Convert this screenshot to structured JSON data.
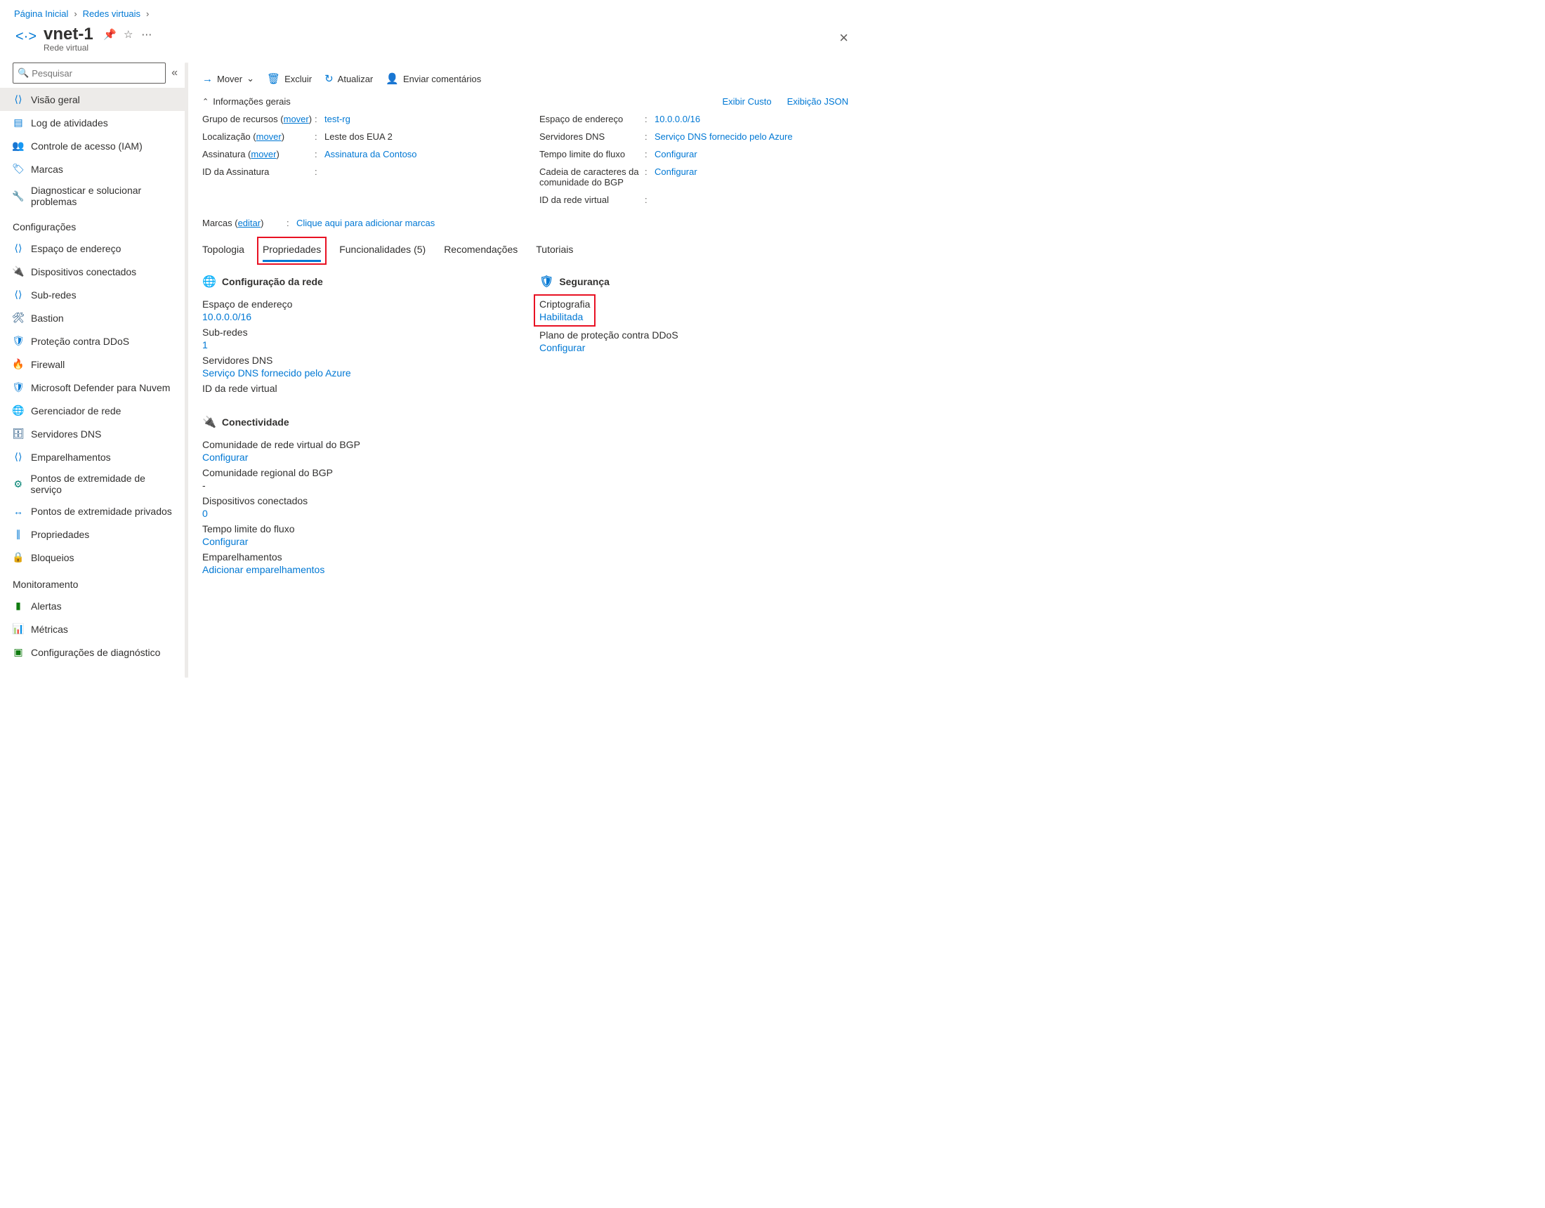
{
  "breadcrumb": {
    "home": "Página Inicial",
    "vnets": "Redes virtuais"
  },
  "header": {
    "title": "vnet-1",
    "subtitle": "Rede virtual"
  },
  "search_placeholder": "Pesquisar",
  "nav": {
    "overview": "Visão geral",
    "activity": "Log de atividades",
    "iam": "Controle de acesso (IAM)",
    "tags": "Marcas",
    "diagnose": "Diagnosticar e solucionar problemas",
    "group_settings": "Configurações",
    "address": "Espaço de endereço",
    "devices": "Dispositivos conectados",
    "subnets": "Sub-redes",
    "bastion": "Bastion",
    "ddos": "Proteção contra DDoS",
    "firewall": "Firewall",
    "defender": "Microsoft Defender para Nuvem",
    "netmgr": "Gerenciador de rede",
    "dns": "Servidores DNS",
    "peerings": "Emparelhamentos",
    "svcendpts": "Pontos de extremidade de serviço",
    "privendpts": "Pontos de extremidade privados",
    "properties": "Propriedades",
    "locks": "Bloqueios",
    "group_monitor": "Monitoramento",
    "alerts": "Alertas",
    "metrics": "Métricas",
    "diagset": "Configurações de diagnóstico"
  },
  "toolbar": {
    "move": "Mover",
    "delete": "Excluir",
    "refresh": "Atualizar",
    "feedback": "Enviar comentários"
  },
  "essentials": {
    "header": "Informações gerais",
    "show_cost": "Exibir Custo",
    "json_view": "Exibição JSON",
    "left": {
      "rg_lbl": "Grupo de recursos (",
      "mover": "mover",
      "rg_val": "test-rg",
      "loc_lbl": "Localização (",
      "loc_val": "Leste dos EUA 2",
      "sub_lbl": "Assinatura (",
      "sub_val": "Assinatura da Contoso",
      "subid_lbl": "ID da Assinatura"
    },
    "right": {
      "addr_lbl": "Espaço de endereço",
      "addr_val": "10.0.0.0/16",
      "dns_lbl": "Servidores DNS",
      "dns_val": "Serviço DNS fornecido pelo Azure",
      "flow_lbl": "Tempo limite do fluxo",
      "flow_val": "Configurar",
      "bgp_lbl": "Cadeia de caracteres da comunidade do BGP",
      "bgp_val": "Configurar",
      "vid_lbl": "ID da rede virtual"
    },
    "tags_lbl": "Marcas (",
    "tags_edit": "editar",
    "tags_val": "Clique aqui para adicionar marcas"
  },
  "tabs": {
    "topology": "Topologia",
    "properties": "Propriedades",
    "capabilities": "Funcionalidades (5)",
    "recommendations": "Recomendações",
    "tutorials": "Tutoriais"
  },
  "netconf": {
    "header": "Configuração da rede",
    "addr_lbl": "Espaço de endereço",
    "addr_val": "10.0.0.0/16",
    "sub_lbl": "Sub-redes",
    "sub_val": "1",
    "dns_lbl": "Servidores DNS",
    "dns_val": "Serviço DNS fornecido pelo Azure",
    "vid_lbl": "ID da rede virtual"
  },
  "security": {
    "header": "Segurança",
    "enc_lbl": "Criptografia",
    "enc_val": "Habilitada",
    "ddos_lbl": "Plano de proteção contra DDoS",
    "ddos_val": "Configurar"
  },
  "connectivity": {
    "header": "Conectividade",
    "bgp_vnet_lbl": "Comunidade de rede virtual do BGP",
    "bgp_vnet_val": "Configurar",
    "bgp_reg_lbl": "Comunidade regional do BGP",
    "bgp_reg_val": "-",
    "dev_lbl": "Dispositivos conectados",
    "dev_val": "0",
    "flow_lbl": "Tempo limite do fluxo",
    "flow_val": "Configurar",
    "peer_lbl": "Emparelhamentos",
    "peer_val": "Adicionar emparelhamentos"
  }
}
